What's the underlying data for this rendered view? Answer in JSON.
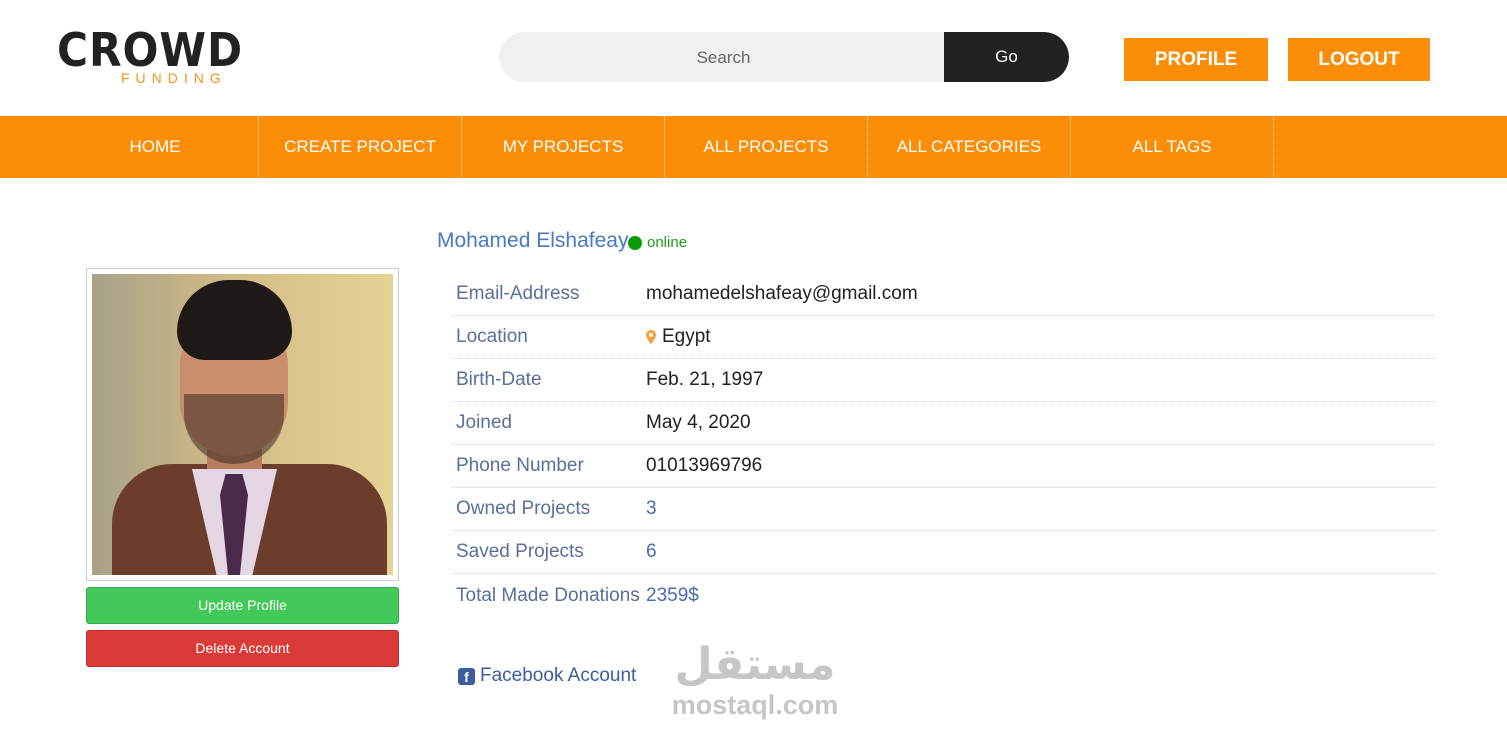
{
  "header": {
    "logo_main": "CROWD",
    "logo_sub": "FUNDING",
    "search_placeholder": "Search",
    "go_label": "Go",
    "profile_label": "PROFILE",
    "logout_label": "LOGOUT"
  },
  "nav": {
    "items": [
      {
        "label": "HOME"
      },
      {
        "label": "CREATE PROJECT"
      },
      {
        "label": "MY PROJECTS"
      },
      {
        "label": "ALL PROJECTS"
      },
      {
        "label": "ALL CATEGORIES"
      },
      {
        "label": "ALL TAGS"
      }
    ]
  },
  "profile": {
    "name": "Mohamed Elshafeay",
    "status": "online",
    "update_label": "Update Profile",
    "delete_label": "Delete Account",
    "fields": [
      {
        "label": "Email-Address",
        "value": "mohamedelshafeay@gmail.com"
      },
      {
        "label": "Location",
        "value": "Egypt"
      },
      {
        "label": "Birth-Date",
        "value": "Feb. 21, 1997"
      },
      {
        "label": "Joined",
        "value": "May 4, 2020"
      },
      {
        "label": "Phone Number",
        "value": "01013969796"
      },
      {
        "label": "Owned Projects",
        "value": "3"
      },
      {
        "label": "Saved Projects",
        "value": "6"
      },
      {
        "label": "Total Made Donations",
        "value": "2359$"
      }
    ],
    "facebook_label": "Facebook Account"
  },
  "watermark": {
    "arabic": "مستقل",
    "latin": "mostaql.com"
  },
  "colors": {
    "accent": "#fc8d06",
    "online": "#0a9a0a",
    "update": "#42c95a",
    "delete": "#db3b38"
  }
}
